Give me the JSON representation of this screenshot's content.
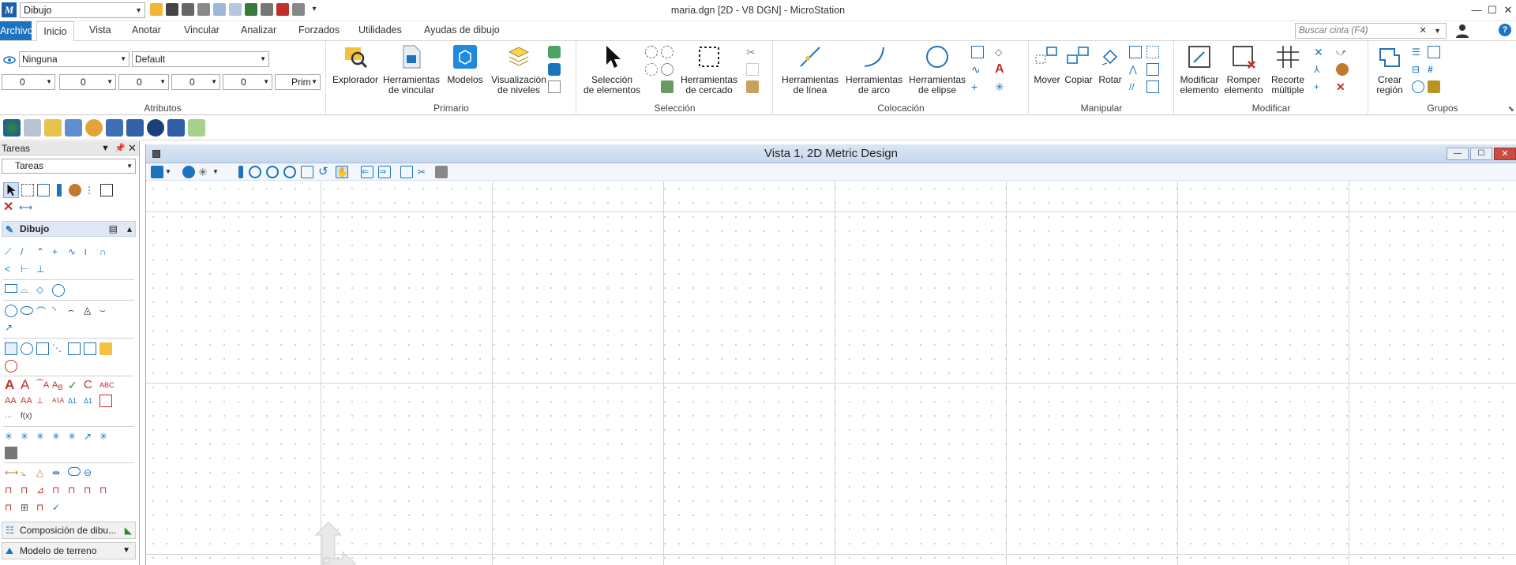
{
  "app": {
    "workspace_value": "Dibujo",
    "window_title": "maria.dgn [2D - V8 DGN] - MicroStation",
    "logo_letter": "M"
  },
  "menu": {
    "tabs": [
      "Archivo",
      "Inicio",
      "Vista",
      "Anotar",
      "Vincular",
      "Analizar",
      "Forzados",
      "Utilidades",
      "Ayudas de dibujo"
    ],
    "search_placeholder": "Buscar cinta (F4)",
    "help_label": "?"
  },
  "ribbon": {
    "atributos": {
      "label": "Atributos",
      "level_value": "Ninguna",
      "style_value": "Default",
      "color_value": "0",
      "weight_value": "0",
      "linestyle_value": "0",
      "transparency_value": "0",
      "priority_value": "0",
      "class_value": "Prim"
    },
    "primario": {
      "label": "Primario",
      "explorador": "Explorador",
      "herr_vincular_1": "Herramientas",
      "herr_vincular_2": "de vincular",
      "modelos": "Modelos",
      "visualizacion_1": "Visualización",
      "visualizacion_2": "de niveles"
    },
    "seleccion": {
      "label": "Selección",
      "sel_1": "Selección",
      "sel_2": "de elementos",
      "cercado_1": "Herramientas",
      "cercado_2": "de cercado"
    },
    "colocacion": {
      "label": "Colocación",
      "linea_1": "Herramientas",
      "linea_2": "de línea",
      "arco_1": "Herramientas",
      "arco_2": "de arco",
      "elipse_1": "Herramientas",
      "elipse_2": "de elipse"
    },
    "manipular": {
      "label": "Manipular",
      "mover": "Mover",
      "copiar": "Copiar",
      "rotar": "Rotar"
    },
    "modificar": {
      "label": "Modificar",
      "modificar_1": "Modificar",
      "modificar_2": "elemento",
      "romper_1": "Romper",
      "romper_2": "elemento",
      "recorte_1": "Recorte",
      "recorte_2": "múltiple"
    },
    "grupos": {
      "label": "Grupos",
      "crear_1": "Crear",
      "crear_2": "región"
    }
  },
  "panel": {
    "header": "Tareas",
    "combo_value": "Tareas",
    "section_dibujo": "Dibujo",
    "bottom_1": "Composición de dibu...",
    "bottom_2": "Modelo de terreno"
  },
  "view": {
    "title": "Vista 1, 2D Metric Design"
  },
  "colors": {
    "accent": "#1e73be",
    "red": "#c0302b",
    "grid_line": "#d4d4d4"
  }
}
